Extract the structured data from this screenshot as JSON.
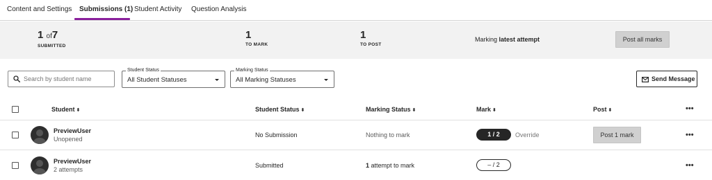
{
  "tabs": [
    {
      "label": "Content and Settings",
      "active": false
    },
    {
      "label": "Submissions (1)",
      "active": true
    },
    {
      "label": "Student Activity",
      "active": false
    },
    {
      "label": "Question Analysis",
      "active": false
    }
  ],
  "colors": {
    "accent": "#8a1f9c",
    "summary_bg": "#f2f2f2",
    "button_grey": "#d0d0d0"
  },
  "summary": {
    "submitted": {
      "value": "1",
      "of": "of",
      "total": "7",
      "label": "SUBMITTED"
    },
    "to_mark": {
      "value": "1",
      "label": "TO MARK"
    },
    "to_post": {
      "value": "1",
      "label": "TO POST"
    },
    "marking_prefix": "Marking",
    "marking_mode": "latest attempt",
    "post_all_label": "Post all marks"
  },
  "filters": {
    "search_placeholder": "Search by student name",
    "student_status": {
      "legend": "Student Status",
      "value": "All Student Statuses"
    },
    "marking_status": {
      "legend": "Marking Status",
      "value": "All Marking Statuses"
    },
    "send_message_label": "Send Message"
  },
  "table": {
    "headers": {
      "student": "Student",
      "student_status": "Student Status",
      "marking_status": "Marking Status",
      "mark": "Mark",
      "post": "Post"
    },
    "sort_glyph": "⬍",
    "more_glyph": "•••",
    "rows": [
      {
        "name": "PreviewUser",
        "detail": "Unopened",
        "student_status": "No Submission",
        "marking_status": "Nothing to mark",
        "mark": "1 / 2",
        "override": "Override",
        "post": "Post 1 mark"
      },
      {
        "name": "PreviewUser",
        "detail": "2 attempts",
        "student_status": "Submitted",
        "marking_status_count": "1",
        "marking_status_rest": "attempt to mark",
        "mark": "– / 2"
      }
    ]
  }
}
